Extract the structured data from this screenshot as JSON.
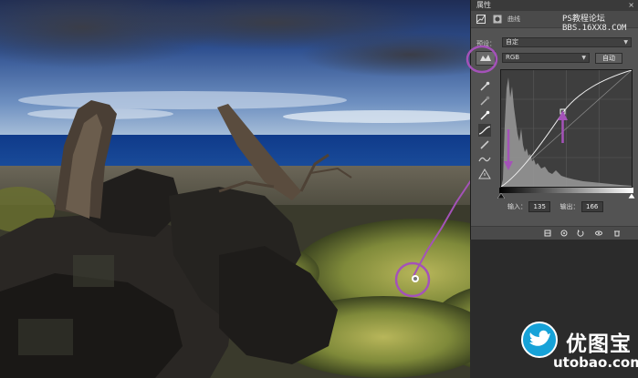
{
  "panel": {
    "tab_label": "属性",
    "close_glyph": "×",
    "titlebar_label": "曲线",
    "watermark_line1": "PS教程论坛",
    "watermark_line2": "BBS.16XX8.COM"
  },
  "preset": {
    "label": "预设：",
    "value": "自定"
  },
  "channel": {
    "value": "RGB",
    "auto_button": "自动"
  },
  "io": {
    "input_label": "输入：",
    "input_value": "135",
    "output_label": "输出：",
    "output_value": "166"
  },
  "logo": {
    "cn": "优图宝",
    "en": "utobao.com"
  },
  "colors": {
    "annotation": "#a452b8",
    "panel_bg": "#535353",
    "curve_bg": "#3e3e3e"
  },
  "icons": {
    "sample_target": "hand-target-icon",
    "eyedropper_black": "eyedropper-black-icon",
    "eyedropper_gray": "eyedropper-gray-icon",
    "eyedropper_white": "eyedropper-white-icon",
    "curve_edit": "curve-point-icon",
    "pencil": "pencil-icon",
    "smooth": "smooth-icon",
    "histogram_warning": "histogram-warning-icon"
  }
}
